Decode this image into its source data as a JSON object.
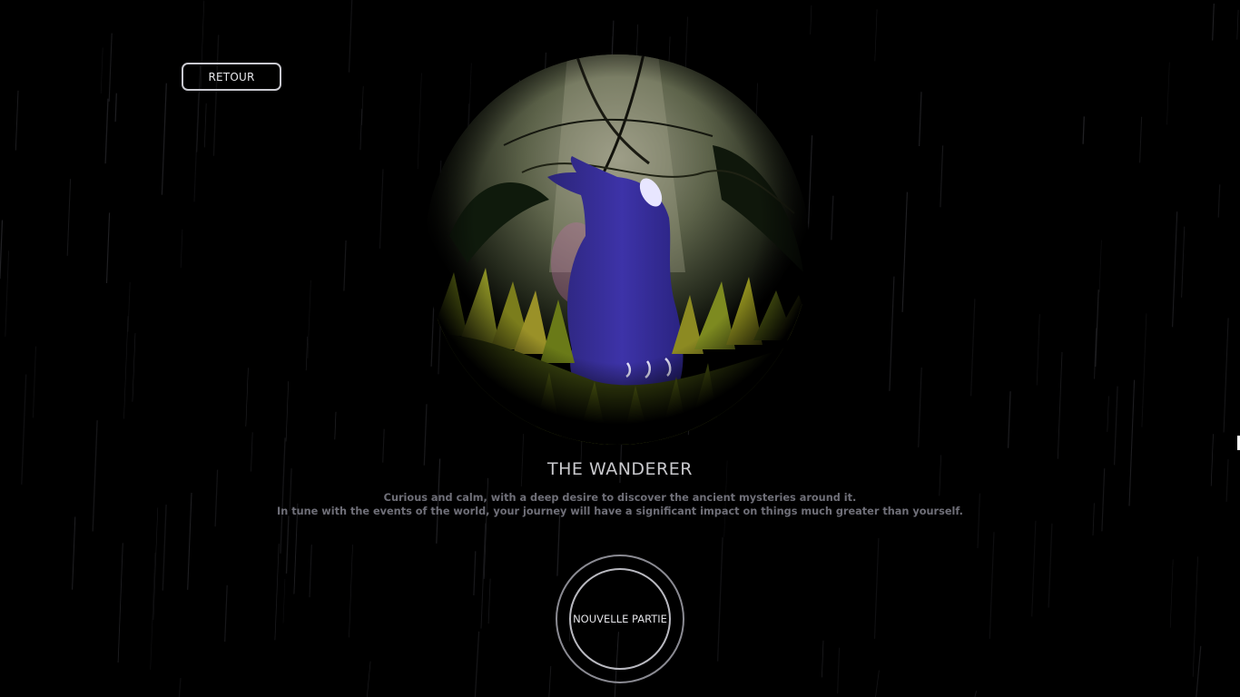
{
  "back_button": {
    "label": "RETOUR"
  },
  "character": {
    "name": "THE WANDERER",
    "description_line_1": "Curious and calm, with a deep desire to discover the ancient mysteries around it.",
    "description_line_2": "In tune with the events of the world, your journey will have a significant impact on things much greater than yourself."
  },
  "new_game_button": {
    "label": "NOUVELLE PARTIE"
  },
  "colors": {
    "background": "#000000",
    "creature": "#3a2f9e",
    "foliage": "#7a8a1e",
    "button_border": "#c9c9d0",
    "title_text": "#c8c8cc",
    "description_text": "#6f6f78"
  }
}
